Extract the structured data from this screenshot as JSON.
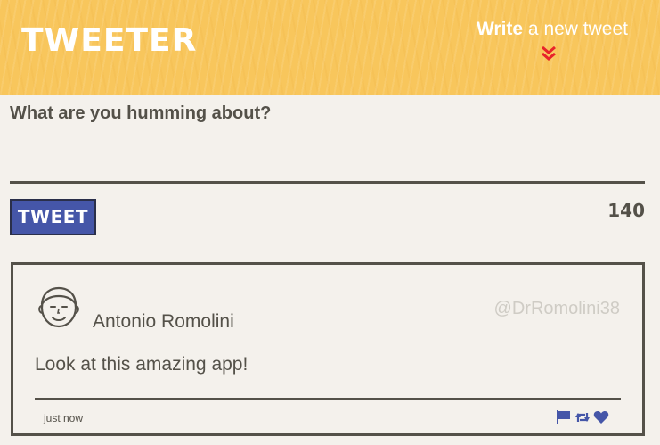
{
  "header": {
    "logo": "TWEETER",
    "compose_toggle_bold": "Write",
    "compose_toggle_rest": " a new tweet"
  },
  "compose": {
    "label": "What are you humming about?",
    "textarea_value": "",
    "tweet_button_label": "TWEET",
    "char_count": "140"
  },
  "tweets": [
    {
      "author_name": "Antonio Romolini",
      "handle": "@DrRomolini38",
      "content": "Look at this amazing app!",
      "timestamp": "just now",
      "avatar_icon": "smiling-face-avatar",
      "actions": [
        "flag-icon",
        "retweet-icon",
        "heart-icon"
      ]
    }
  ],
  "colors": {
    "header_bg": "#f8c65c",
    "page_bg": "#f4f1ec",
    "text": "#545149",
    "accent_blue": "#4556a8",
    "chevron_red": "#e8242a",
    "handle_gray": "#cfccc5"
  }
}
